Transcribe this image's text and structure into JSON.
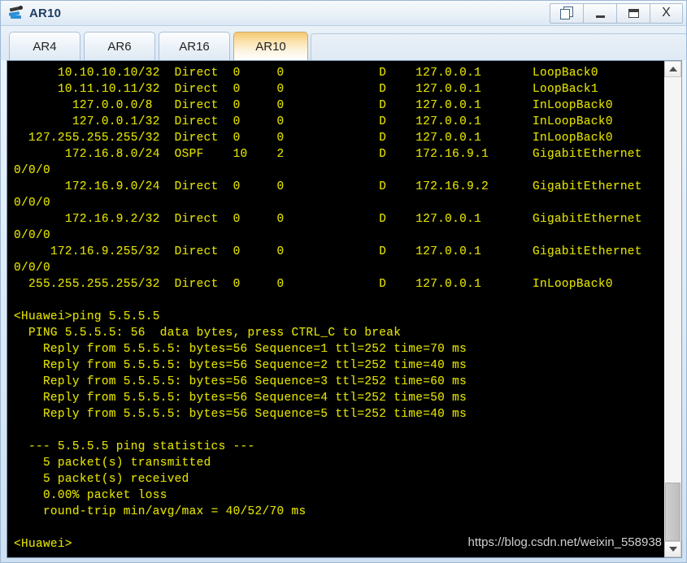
{
  "window": {
    "title": "AR10",
    "icon": "router-icon",
    "controls": [
      {
        "name": "restore-button",
        "label": ""
      },
      {
        "name": "minimize-button",
        "label": ""
      },
      {
        "name": "maximize-button",
        "label": ""
      },
      {
        "name": "close-button",
        "label": "X"
      }
    ]
  },
  "tabs": [
    {
      "label": "AR4",
      "active": false
    },
    {
      "label": "AR6",
      "active": false
    },
    {
      "label": "AR16",
      "active": false
    },
    {
      "label": "AR10",
      "active": true
    }
  ],
  "terminal": {
    "foreground_color": "#d8d800",
    "background_color": "#000000",
    "lines": [
      "      10.10.10.10/32  Direct  0     0             D    127.0.0.1       LoopBack0",
      "      10.11.10.11/32  Direct  0     0             D    127.0.0.1       LoopBack1",
      "        127.0.0.0/8   Direct  0     0             D    127.0.0.1       InLoopBack0",
      "        127.0.0.1/32  Direct  0     0             D    127.0.0.1       InLoopBack0",
      "  127.255.255.255/32  Direct  0     0             D    127.0.0.1       InLoopBack0",
      "       172.16.8.0/24  OSPF    10    2             D    172.16.9.1      GigabitEthernet",
      "0/0/0",
      "       172.16.9.0/24  Direct  0     0             D    172.16.9.2      GigabitEthernet",
      "0/0/0",
      "       172.16.9.2/32  Direct  0     0             D    127.0.0.1       GigabitEthernet",
      "0/0/0",
      "     172.16.9.255/32  Direct  0     0             D    127.0.0.1       GigabitEthernet",
      "0/0/0",
      "  255.255.255.255/32  Direct  0     0             D    127.0.0.1       InLoopBack0",
      "",
      "<Huawei>ping 5.5.5.5",
      "  PING 5.5.5.5: 56  data bytes, press CTRL_C to break",
      "    Reply from 5.5.5.5: bytes=56 Sequence=1 ttl=252 time=70 ms",
      "    Reply from 5.5.5.5: bytes=56 Sequence=2 ttl=252 time=40 ms",
      "    Reply from 5.5.5.5: bytes=56 Sequence=3 ttl=252 time=60 ms",
      "    Reply from 5.5.5.5: bytes=56 Sequence=4 ttl=252 time=50 ms",
      "    Reply from 5.5.5.5: bytes=56 Sequence=5 ttl=252 time=40 ms",
      "",
      "  --- 5.5.5.5 ping statistics ---",
      "    5 packet(s) transmitted",
      "    5 packet(s) received",
      "    0.00% packet loss",
      "    round-trip min/avg/max = 40/52/70 ms",
      "",
      "<Huawei>"
    ]
  },
  "scrollbar": {
    "up_arrow": "chevron-up-icon",
    "down_arrow": "chevron-down-icon"
  },
  "watermark": {
    "text": "https://blog.csdn.net/weixin_558938"
  }
}
